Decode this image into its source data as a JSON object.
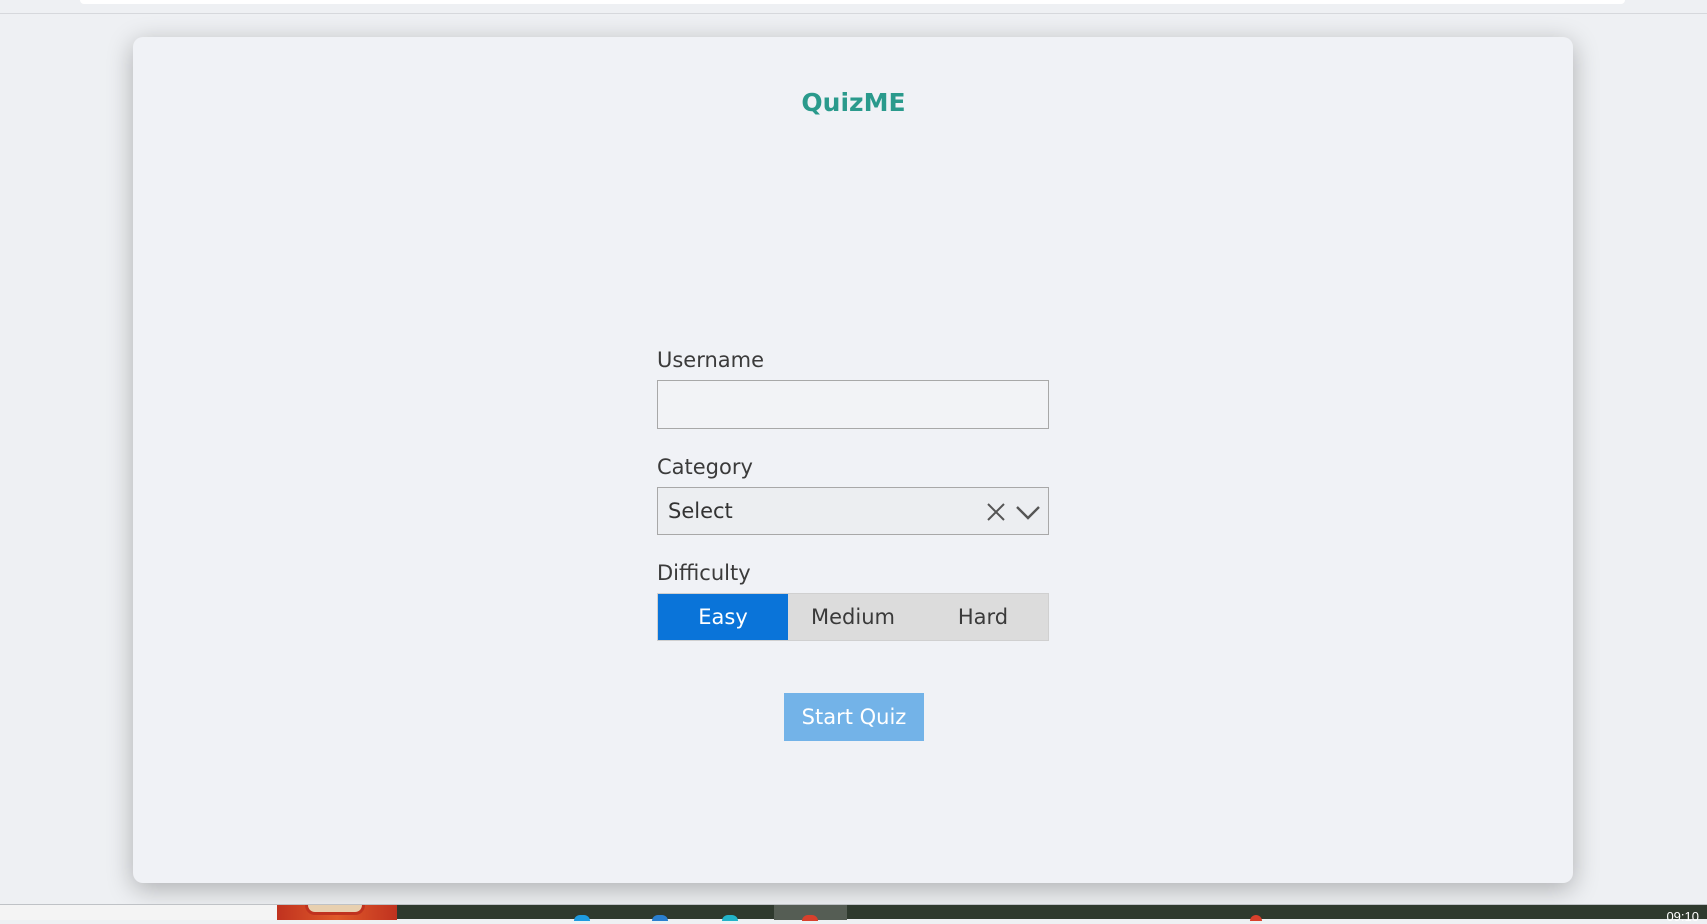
{
  "app": {
    "title": "QuizME"
  },
  "form": {
    "username": {
      "label": "Username",
      "value": "",
      "placeholder": ""
    },
    "category": {
      "label": "Category",
      "selected": "Select"
    },
    "difficulty": {
      "label": "Difficulty",
      "options": [
        "Easy",
        "Medium",
        "Hard"
      ],
      "selected": "Easy"
    },
    "submit_label": "Start Quiz"
  },
  "taskbar": {
    "clock": "09:10"
  },
  "colors": {
    "title": "#2a9a8c",
    "active_segment": "#0a74d9",
    "start_button": "#73b3e8"
  }
}
